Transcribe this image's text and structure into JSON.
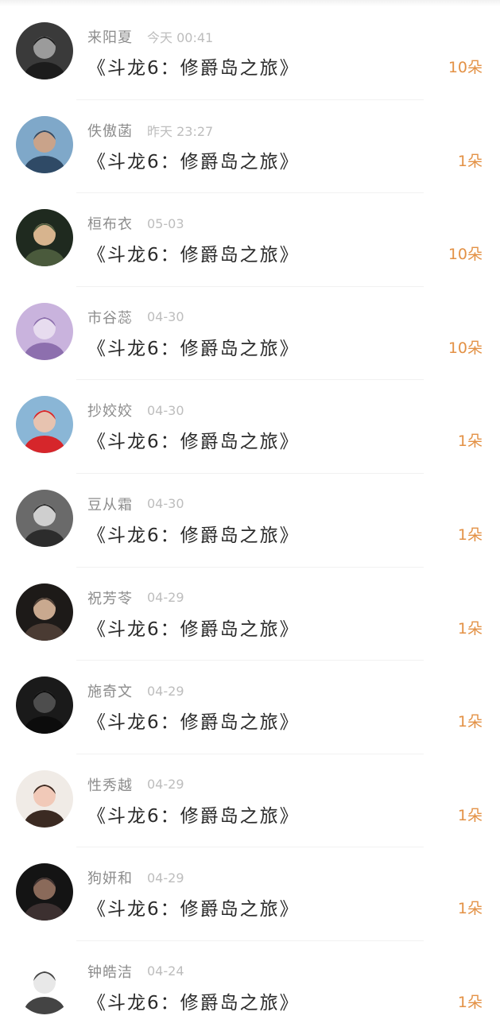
{
  "records": [
    {
      "name": "来阳夏",
      "time": "今天 00:41",
      "title": "《斗龙6：修爵岛之旅》",
      "count": "10朵",
      "avatar_icon": "avatar-dark-hat-icon",
      "avatar_colors": [
        "#3a3a3a",
        "#9b9b9b",
        "#1c1c1c"
      ]
    },
    {
      "name": "佚傲菡",
      "time": "昨天 23:27",
      "title": "《斗龙6：修爵岛之旅》",
      "count": "1朵",
      "avatar_icon": "avatar-selfie-icon",
      "avatar_colors": [
        "#7fa8c9",
        "#c9a38a",
        "#2f4a66"
      ]
    },
    {
      "name": "桓布衣",
      "time": "05-03",
      "title": "《斗龙6：修爵岛之旅》",
      "count": "10朵",
      "avatar_icon": "avatar-standing-man-icon",
      "avatar_colors": [
        "#1f2a1f",
        "#d7b48e",
        "#4a5a3c"
      ]
    },
    {
      "name": "市谷蕊",
      "time": "04-30",
      "title": "《斗龙6：修爵岛之旅》",
      "count": "10朵",
      "avatar_icon": "avatar-lavender-text-icon",
      "avatar_colors": [
        "#c9b3dd",
        "#e7dcef",
        "#8d6fae"
      ]
    },
    {
      "name": "抄姣姣",
      "time": "04-30",
      "title": "《斗龙6：修爵岛之旅》",
      "count": "1朵",
      "avatar_icon": "avatar-girl-red-sign-icon",
      "avatar_colors": [
        "#8ab6d6",
        "#e7c3b0",
        "#d6262b"
      ]
    },
    {
      "name": "豆从霜",
      "time": "04-30",
      "title": "《斗龙6：修爵岛之旅》",
      "count": "1朵",
      "avatar_icon": "avatar-grayscale-couple-icon",
      "avatar_colors": [
        "#6a6a6a",
        "#cfcfcf",
        "#2c2c2c"
      ]
    },
    {
      "name": "祝芳苓",
      "time": "04-29",
      "title": "《斗龙6：修爵岛之旅》",
      "count": "1朵",
      "avatar_icon": "avatar-dark-portrait-icon",
      "avatar_colors": [
        "#1d1a18",
        "#c9a98f",
        "#4a3b33"
      ]
    },
    {
      "name": "施奇文",
      "time": "04-29",
      "title": "《斗龙6：修爵岛之旅》",
      "count": "1朵",
      "avatar_icon": "avatar-black-silhouette-icon",
      "avatar_colors": [
        "#1a1a1a",
        "#4d4d4d",
        "#0c0c0c"
      ]
    },
    {
      "name": "性秀越",
      "time": "04-29",
      "title": "《斗龙6：修爵岛之旅》",
      "count": "1朵",
      "avatar_icon": "avatar-girl-bob-hair-icon",
      "avatar_colors": [
        "#f0ebe6",
        "#f1c9b8",
        "#3b2a22"
      ]
    },
    {
      "name": "狗妍和",
      "time": "04-29",
      "title": "《斗龙6：修爵岛之旅》",
      "count": "1朵",
      "avatar_icon": "avatar-night-scene-icon",
      "avatar_colors": [
        "#141414",
        "#8a6a5a",
        "#3c3030"
      ]
    },
    {
      "name": "钟皓洁",
      "time": "04-24",
      "title": "《斗龙6：修爵岛之旅》",
      "count": "1朵",
      "avatar_icon": "avatar-cartoon-snowman-icon",
      "avatar_colors": [
        "#ffffff",
        "#e8e8e8",
        "#444444"
      ]
    }
  ]
}
